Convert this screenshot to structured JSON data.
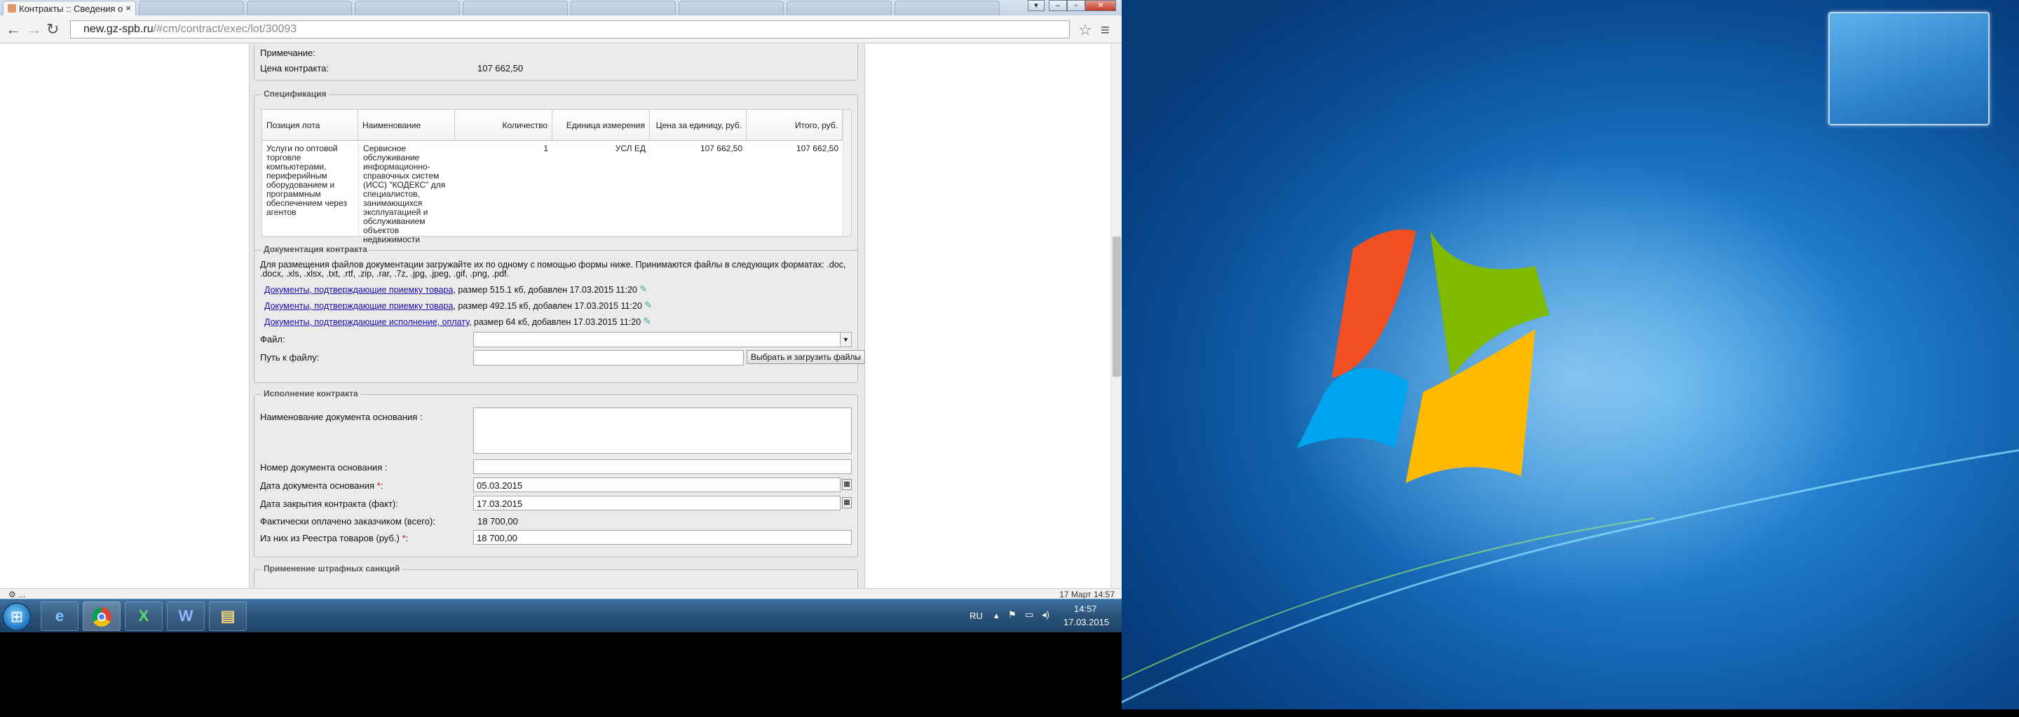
{
  "browser": {
    "tab_active": "Контракты :: Сведения о",
    "tab_close": "×",
    "url_host": "new.gz-spb.ru",
    "url_path": "/#cm/contract/exec/lot/30093"
  },
  "contract": {
    "note_label": "Примечание:",
    "price_label": "Цена контракта:",
    "price_value": "107 662,50"
  },
  "spec": {
    "legend": "Спецификация",
    "headers": [
      "Позиция лота",
      "Наименование",
      "Количество",
      "Единица измерения",
      "Цена за единицу, руб.",
      "Итого, руб."
    ],
    "row": {
      "position": "Услуги по оптовой торговле компьютерами, периферийным оборудованием и программным обеспечением через агентов",
      "name": "Сервисное обслуживание информационно-справочных систем (ИСС) \"КОДЕКС\" для специалистов, занимающихся эксплуатацией и обслуживанием объектов недвижимости",
      "qty": "1",
      "unit": "УСЛ ЕД",
      "price": "107 662,50",
      "total": "107 662,50"
    }
  },
  "docs": {
    "legend": "Документация контракта",
    "info_line1": "Для размещения файлов документации загружайте их по одному с помощью формы ниже. Принимаются файлы в следующих форматах: .doc,",
    "info_line2": ".docx, .xls, .xlsx, .txt, .rtf, .zip, .rar, .7z, .jpg, .jpeg, .gif, .png, .pdf.",
    "files": [
      {
        "link": "Документы, подтверждающие приемку товара",
        "info": ", размер 515.1 кб, добавлен 17.03.2015 11:20"
      },
      {
        "link": "Документы, подтверждающие приемку товара",
        "info": ", размер 492.15 кб, добавлен 17.03.2015 11:20"
      },
      {
        "link": "Документы, подтверждающие исполнение, оплату",
        "info": ", размер 64 кб, добавлен 17.03.2015 11:20"
      }
    ],
    "file_label": "Файл:",
    "path_label": "Путь к файлу:",
    "upload_button": "Выбрать и загрузить файлы"
  },
  "execution": {
    "legend": "Исполнение контракта",
    "doc_name_label": "Наименование документа основания :",
    "doc_number_label": "Номер документа основания :",
    "doc_date_label": "Дата документа основания",
    "doc_date_value": "05.03.2015",
    "close_date_label": "Дата закрытия контракта (факт):",
    "close_date_value": "17.03.2015",
    "paid_label": "Фактически оплачено заказчиком (всего):",
    "paid_value": "18 700,00",
    "registry_label": "Из них из Реестра товаров (руб.)",
    "registry_value": "18 700,00",
    "required_mark": "*",
    "colon": ":"
  },
  "penalty": {
    "legend": "Применение штрафных санкций"
  },
  "status_bar": {
    "left": "⚙ ...",
    "right": "17 Март 14:57"
  },
  "taskbar": {
    "lang": "RU",
    "time": "14:57",
    "date": "17.03.2015"
  },
  "icons": [
    "chrome-icon",
    "ie-icon",
    "excel-icon",
    "word-icon",
    "explorer-icon",
    "flag-icon",
    "network-icon",
    "volume-icon",
    "star-icon",
    "menu-icon"
  ]
}
